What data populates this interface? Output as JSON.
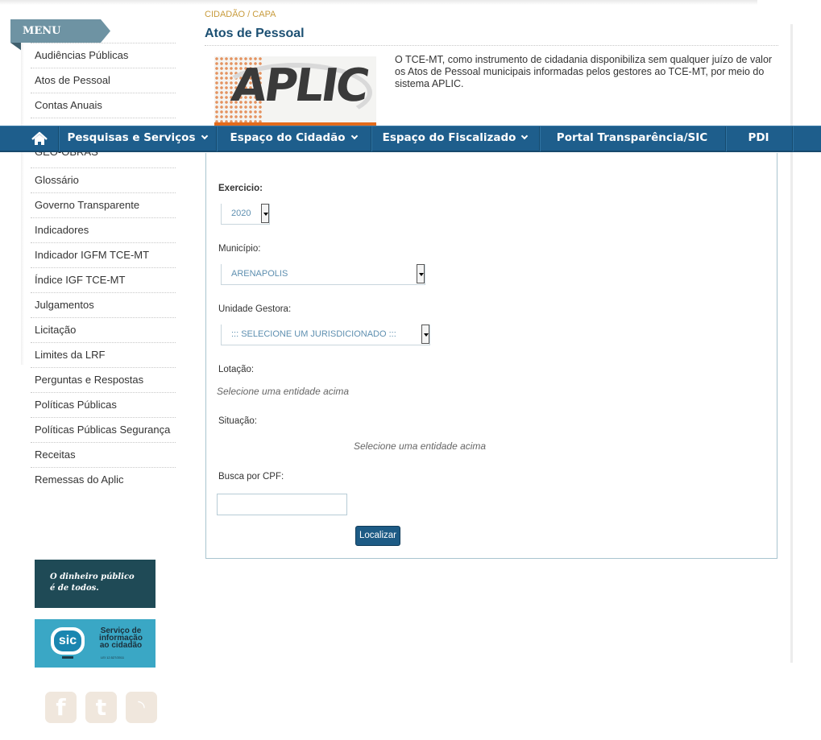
{
  "sidebar": {
    "menu_label": "MENU",
    "items": [
      {
        "label": "Audiências Públicas"
      },
      {
        "label": "Atos de Pessoal"
      },
      {
        "label": "Contas Anuais"
      },
      {
        "label": ""
      },
      {
        "label": "GEO-OBRAS"
      },
      {
        "label": "Glossário"
      },
      {
        "label": "Governo Transparente"
      },
      {
        "label": "Indicadores"
      },
      {
        "label": "Indicador IGFM TCE-MT"
      },
      {
        "label": "Índice IGF TCE-MT"
      },
      {
        "label": "Julgamentos"
      },
      {
        "label": "Licitação"
      },
      {
        "label": "Limites da LRF"
      },
      {
        "label": "Perguntas e Respostas"
      },
      {
        "label": "Políticas Públicas"
      },
      {
        "label": "Políticas Públicas Segurança"
      },
      {
        "label": "Receitas"
      },
      {
        "label": "Remessas do Aplic"
      }
    ],
    "banner_dinheiro": {
      "line1": "O dinheiro público",
      "line2": "é de todos."
    },
    "banner_sic": {
      "logo": "sic",
      "line1": "Serviço de",
      "line2": "informação",
      "line3": "ao cidadão",
      "law": "LEI 12.527/2011"
    },
    "social": [
      {
        "icon": "facebook-icon",
        "glyph": "f"
      },
      {
        "icon": "twitter-icon",
        "glyph": "t"
      },
      {
        "icon": "rss-icon",
        "glyph": "◝"
      }
    ]
  },
  "header": {
    "breadcrumb": "CIDADÃO / CAPA",
    "title": "Atos de Pessoal",
    "logo_text": "APLIC",
    "intro": "O TCE-MT, como instrumento de cidadania disponibiliza sem qualquer juízo de valor os Atos de Pessoal municipais informadas pelos gestores ao TCE-MT, por meio do sistema APLIC."
  },
  "nav": {
    "items": [
      {
        "label": "Pesquisas e Serviços"
      },
      {
        "label": "Espaço do Cidadão"
      },
      {
        "label": "Espaço do Fiscalizado"
      },
      {
        "label": "Portal Transparência/SIC"
      },
      {
        "label": "PDI"
      }
    ]
  },
  "form": {
    "exercicio_label": "Exercicio:",
    "exercicio_value": "2020",
    "municipio_label": "Município:",
    "municipio_value": "ARENAPOLIS",
    "unidade_label": "Unidade Gestora:",
    "unidade_value": "::: SELECIONE UM JURISDICIONADO :::",
    "lotacao_label": "Lotação:",
    "lotacao_hint": "Selecione uma entidade acima",
    "situacao_label": "Situação:",
    "situacao_hint": "Selecione uma entidade acima",
    "cpf_label": "Busca por CPF:",
    "cpf_value": "",
    "submit_label": "Localizar"
  },
  "colors": {
    "nav_bg": "#1e5e8c",
    "title": "#1b4f72",
    "breadcrumb": "#c89b3c",
    "menu_tag": "#6e93a3",
    "button": "#1d5b85"
  }
}
